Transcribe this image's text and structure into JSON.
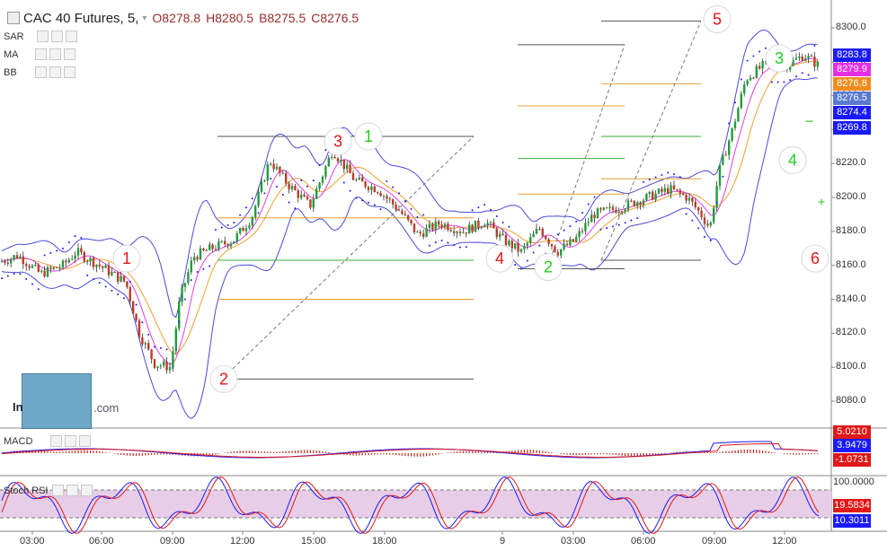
{
  "header": {
    "title": "CAC 40 Futures, 5,",
    "open": "O8278.8",
    "high": "H8280.5",
    "low": "B8275.5",
    "close": "C8276.5"
  },
  "indicators": {
    "sar": "SAR",
    "ma": "MA",
    "bb": "BB",
    "macd": "MACD",
    "stoch": "Stoch RSI"
  },
  "price_tags": [
    {
      "value": "8283.8",
      "color": "#1a1aff"
    },
    {
      "value": "8279.9",
      "color": "#e62ee6"
    },
    {
      "value": "8276.8",
      "color": "#f08c1e"
    },
    {
      "value": "8276.5",
      "color": "#5a7ad2"
    },
    {
      "value": "8274.4",
      "color": "#1a1aff"
    },
    {
      "value": "8269.8",
      "color": "#1a1aff"
    }
  ],
  "macd_tags": [
    {
      "value": "5.0210",
      "color": "#e01818"
    },
    {
      "value": "3.9479",
      "color": "#1a1aff"
    },
    {
      "value": "-1.0731",
      "color": "#e01818"
    }
  ],
  "stoch_tags": [
    {
      "value": "100.0000",
      "color": "none"
    },
    {
      "value": "19.5834",
      "color": "#e01818"
    },
    {
      "value": "10.3011",
      "color": "#1a1aff"
    }
  ],
  "logo": {
    "text": "In",
    "domain": ".com"
  },
  "chart_data": {
    "type": "candlestick",
    "title": "CAC 40 Futures, 5,",
    "yticks": [
      "8300.0",
      "8280.0",
      "8260.0",
      "8240.0",
      "8220.0",
      "8200.0",
      "8180.0",
      "8160.0",
      "8140.0",
      "8120.0",
      "8100.0",
      "8080.0"
    ],
    "ylim": [
      8072,
      8306
    ],
    "xticks": [
      "03:00",
      "06:00",
      "09:00",
      "12:00",
      "15:00",
      "18:00",
      "9",
      "03:00",
      "06:00",
      "09:00",
      "12:00"
    ],
    "price_path": [
      [
        0,
        8162
      ],
      [
        20,
        8166
      ],
      [
        45,
        8155
      ],
      [
        70,
        8160
      ],
      [
        85,
        8168
      ],
      [
        110,
        8160
      ],
      [
        140,
        8150
      ],
      [
        155,
        8120
      ],
      [
        172,
        8102
      ],
      [
        190,
        8100
      ],
      [
        200,
        8140
      ],
      [
        215,
        8165
      ],
      [
        235,
        8170
      ],
      [
        260,
        8175
      ],
      [
        280,
        8188
      ],
      [
        300,
        8222
      ],
      [
        320,
        8208
      ],
      [
        345,
        8195
      ],
      [
        370,
        8228
      ],
      [
        395,
        8210
      ],
      [
        420,
        8205
      ],
      [
        445,
        8192
      ],
      [
        465,
        8178
      ],
      [
        490,
        8185
      ],
      [
        515,
        8180
      ],
      [
        540,
        8186
      ],
      [
        560,
        8175
      ],
      [
        580,
        8168
      ],
      [
        600,
        8182
      ],
      [
        620,
        8168
      ],
      [
        640,
        8175
      ],
      [
        660,
        8190
      ],
      [
        690,
        8194
      ],
      [
        720,
        8200
      ],
      [
        745,
        8205
      ],
      [
        765,
        8200
      ],
      [
        780,
        8190
      ],
      [
        790,
        8182
      ],
      [
        800,
        8215
      ],
      [
        815,
        8240
      ],
      [
        830,
        8270
      ],
      [
        850,
        8278
      ],
      [
        875,
        8278
      ],
      [
        895,
        8284
      ],
      [
        910,
        8278
      ]
    ],
    "horizontal_levels": [
      {
        "y": 8236,
        "x1": 242,
        "x2": 527,
        "color": "#555555"
      },
      {
        "y": 8188,
        "x1": 242,
        "x2": 527,
        "color": "#e6a030"
      },
      {
        "y": 8163,
        "x1": 242,
        "x2": 527,
        "color": "#3aaa3a"
      },
      {
        "y": 8140,
        "x1": 242,
        "x2": 527,
        "color": "#e6a030"
      },
      {
        "y": 8093,
        "x1": 242,
        "x2": 527,
        "color": "#555555"
      },
      {
        "y": 8290,
        "x1": 576,
        "x2": 695,
        "color": "#555555"
      },
      {
        "y": 8254,
        "x1": 576,
        "x2": 695,
        "color": "#e6a030"
      },
      {
        "y": 8223,
        "x1": 576,
        "x2": 695,
        "color": "#3aaa3a"
      },
      {
        "y": 8202,
        "x1": 576,
        "x2": 695,
        "color": "#e6a030"
      },
      {
        "y": 8158,
        "x1": 576,
        "x2": 695,
        "color": "#555555"
      },
      {
        "y": 8304,
        "x1": 669,
        "x2": 780,
        "color": "#555555"
      },
      {
        "y": 8267,
        "x1": 669,
        "x2": 780,
        "color": "#e6a030"
      },
      {
        "y": 8236,
        "x1": 669,
        "x2": 780,
        "color": "#3aaa3a"
      },
      {
        "y": 8211,
        "x1": 669,
        "x2": 780,
        "color": "#e6a030"
      },
      {
        "y": 8163,
        "x1": 669,
        "x2": 780,
        "color": "#555555"
      }
    ],
    "wave_labels": [
      {
        "label": "1",
        "x": 141,
        "y": 8164,
        "color": "#e01818"
      },
      {
        "label": "2",
        "x": 249,
        "y": 8093,
        "color": "#e01818"
      },
      {
        "label": "3",
        "x": 376,
        "y": 8233,
        "color": "#e01818"
      },
      {
        "label": "1",
        "x": 410,
        "y": 8236,
        "color": "#22cc22"
      },
      {
        "label": "4",
        "x": 556,
        "y": 8164,
        "color": "#e01818"
      },
      {
        "label": "2",
        "x": 610,
        "y": 8159,
        "color": "#22cc22"
      },
      {
        "label": "5",
        "x": 798,
        "y": 8305,
        "color": "#e01818"
      },
      {
        "label": "3",
        "x": 867,
        "y": 8282,
        "color": "#22cc22"
      },
      {
        "label": "4",
        "x": 882,
        "y": 8222,
        "color": "#22cc22"
      },
      {
        "label": "6",
        "x": 907,
        "y": 8164,
        "color": "#e01818"
      }
    ]
  }
}
